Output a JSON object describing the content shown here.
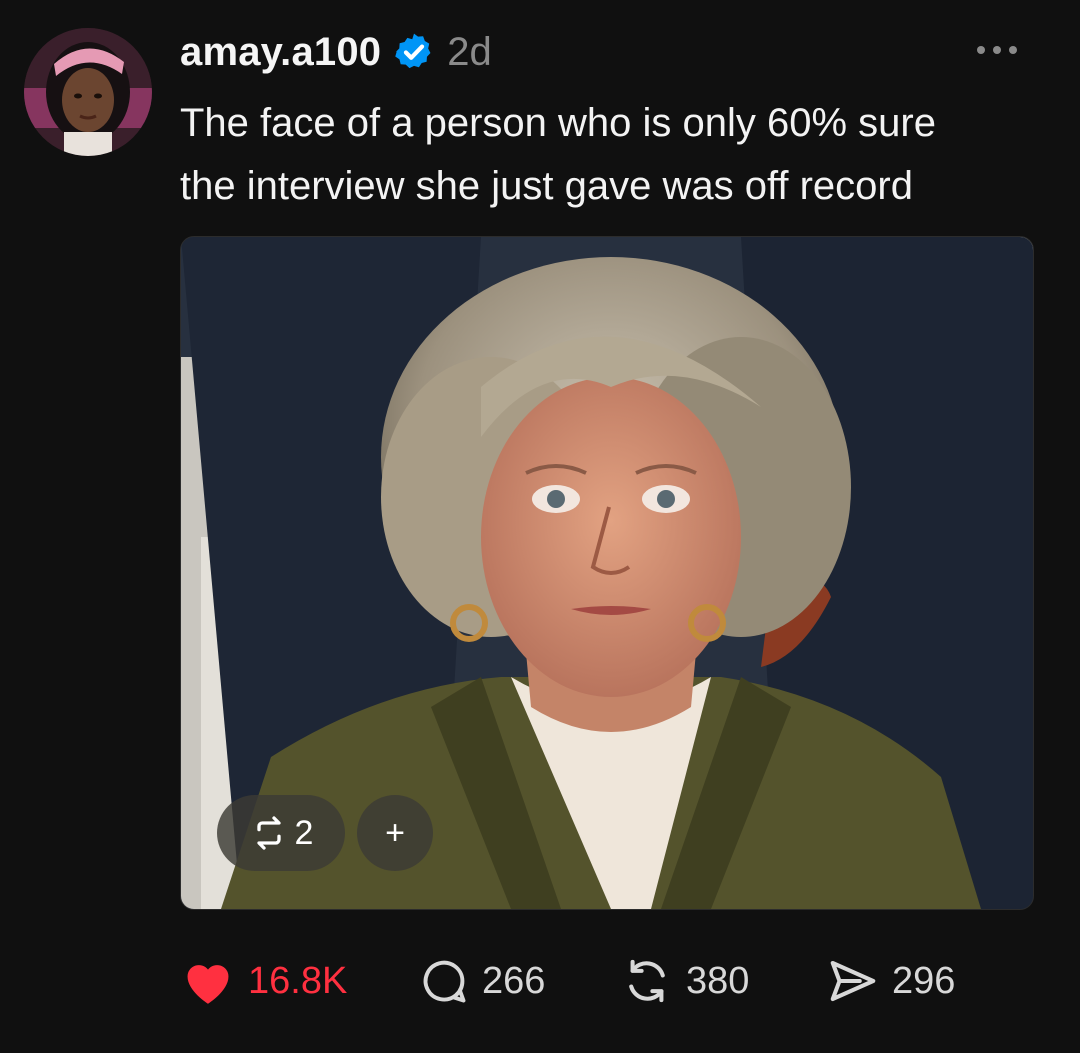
{
  "post": {
    "username": "amay.a100",
    "time": "2d",
    "caption_line1": "The face of a person who is only 60% sure",
    "caption_line2": "the interview she just gave was off record",
    "media_overlay": {
      "repost_count": "2",
      "add_label": "+"
    }
  },
  "actions": {
    "likes": "16.8K",
    "comments": "266",
    "reposts": "380",
    "shares": "296"
  },
  "icons": {
    "verified": "verified-badge-icon",
    "more": "more-options-icon",
    "like": "heart-icon",
    "comment": "comment-bubble-icon",
    "repost": "repost-icon",
    "share": "send-icon"
  },
  "colors": {
    "background": "#101010",
    "verified": "#0095f6",
    "like": "#ff3040",
    "secondary_text": "#8a8a8a"
  }
}
